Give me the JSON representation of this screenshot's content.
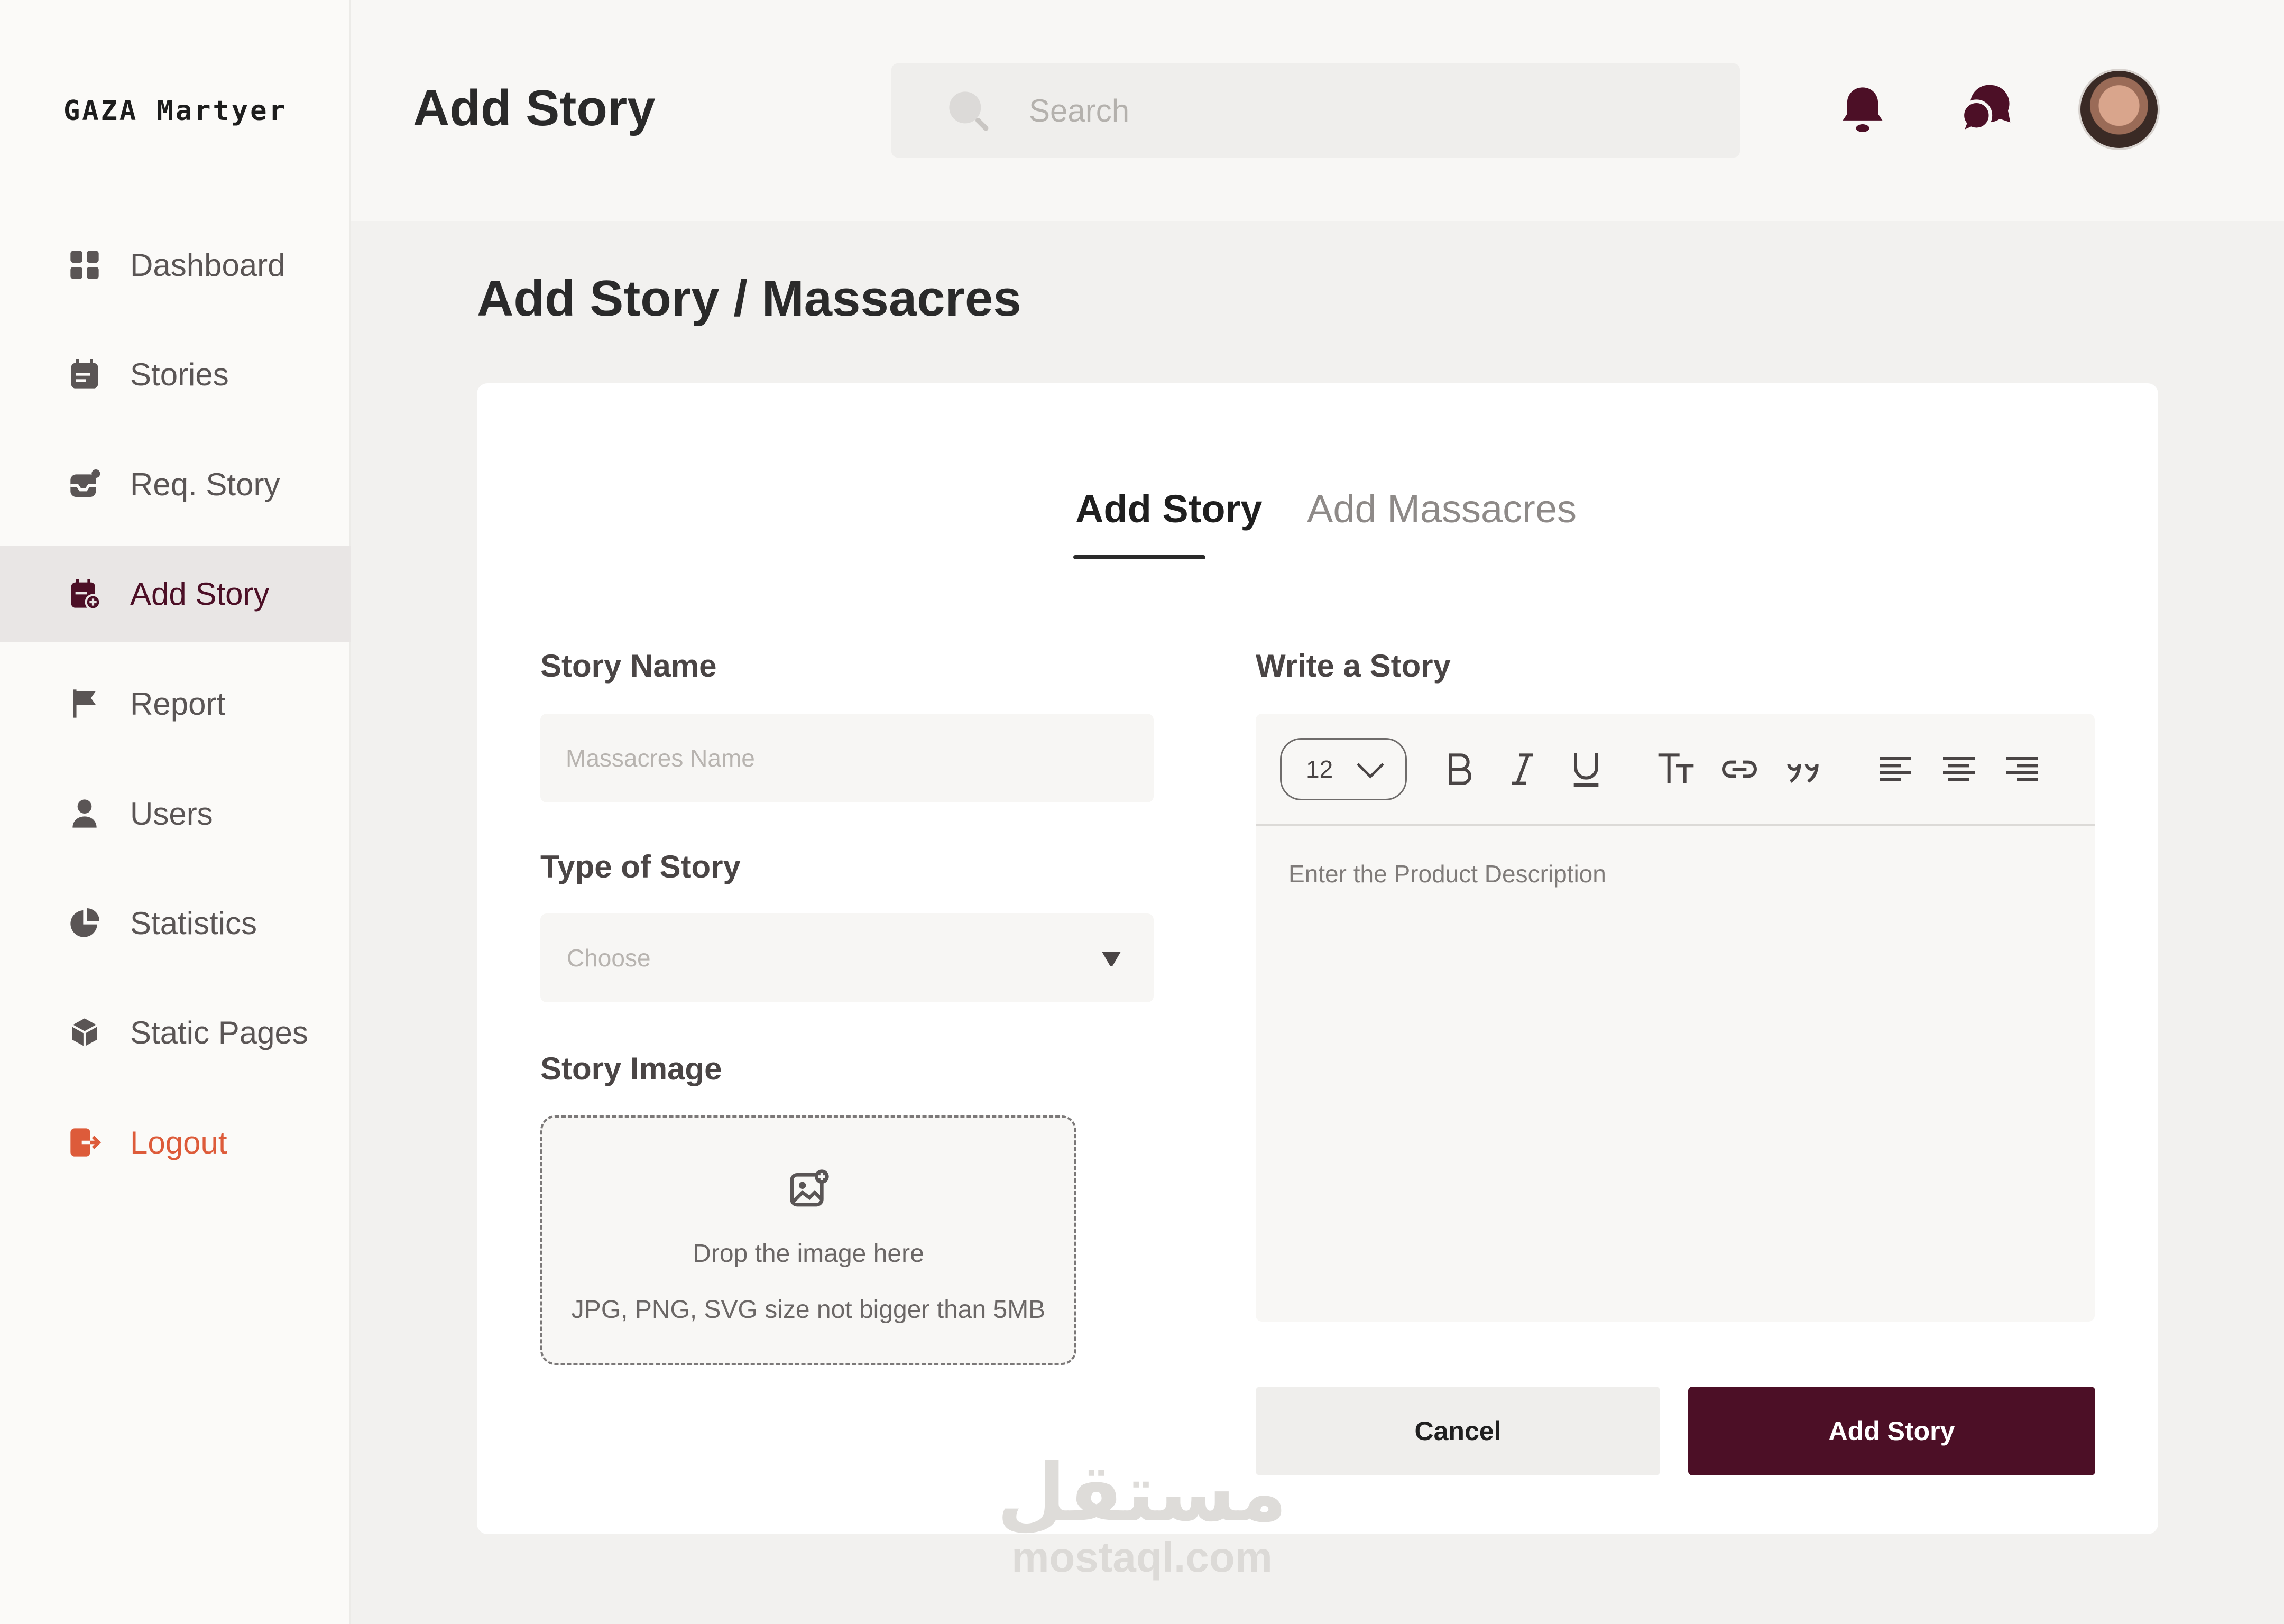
{
  "brand": {
    "logo": "GAZA Martyer",
    "accent": "#4c0f26",
    "danger": "#dd5b3a"
  },
  "sidebar": {
    "items": [
      {
        "label": "Dashboard",
        "icon": "grid-icon"
      },
      {
        "label": "Stories",
        "icon": "calendar-list-icon"
      },
      {
        "label": "Req. Story",
        "icon": "inbox-icon"
      },
      {
        "label": "Add Story",
        "icon": "calendar-add-icon",
        "active": true
      },
      {
        "label": "Report",
        "icon": "flag-icon"
      },
      {
        "label": "Users",
        "icon": "user-icon"
      },
      {
        "label": "Statistics",
        "icon": "pie-chart-icon"
      },
      {
        "label": "Static Pages",
        "icon": "cube-icon"
      },
      {
        "label": "Logout",
        "icon": "logout-icon"
      }
    ]
  },
  "header": {
    "title": "Add Story",
    "search_placeholder": "Search"
  },
  "main": {
    "page_title": "Add Story / Massacres",
    "tabs": [
      {
        "label": "Add Story",
        "active": true
      },
      {
        "label": "Add Massacres",
        "active": false
      }
    ],
    "story_name": {
      "label": "Story Name",
      "placeholder": "Massacres Name"
    },
    "story_type": {
      "label": "Type of Story",
      "selected": "Choose"
    },
    "story_image": {
      "label": "Story Image",
      "drop_text": "Drop the image here",
      "hint": "JPG, PNG, SVG size not bigger than 5MB"
    },
    "editor": {
      "label": "Write a Story",
      "font_size": "12",
      "placeholder": "Enter the Product Description"
    },
    "buttons": {
      "cancel": "Cancel",
      "submit": "Add Story"
    }
  },
  "watermark": {
    "arabic": "مستقل",
    "latin": "mostaql.com"
  }
}
